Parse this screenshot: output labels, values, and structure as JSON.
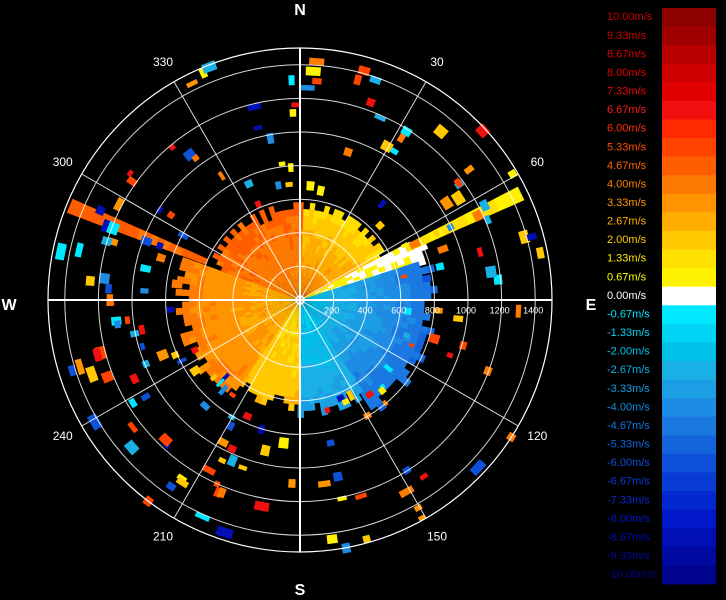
{
  "chart_data": {
    "type": "heatmap",
    "subtype": "polar radial-velocity PPI",
    "cardinal_labels": {
      "north": "N",
      "east": "E",
      "south": "S",
      "west": "W"
    },
    "bearing_labels": [
      {
        "deg": 30,
        "text": "30"
      },
      {
        "deg": 60,
        "text": "60"
      },
      {
        "deg": 120,
        "text": "120"
      },
      {
        "deg": 150,
        "text": "150"
      },
      {
        "deg": 210,
        "text": "210"
      },
      {
        "deg": 240,
        "text": "240"
      },
      {
        "deg": 300,
        "text": "300"
      },
      {
        "deg": 330,
        "text": "330"
      }
    ],
    "range_rings": [
      200,
      400,
      600,
      800,
      1000,
      1200,
      1400
    ],
    "range_labels": [
      "200",
      "400",
      "600",
      "800",
      "1000",
      "1200",
      "1400"
    ],
    "range_max": 1500,
    "spoke_interval_deg": 30,
    "colorbar": [
      {
        "value": 10.0,
        "label": "10.00m/s",
        "color": "#8c0000",
        "text_color": "#cc0000"
      },
      {
        "value": 9.33,
        "label": "9.33m/s",
        "color": "#a00000",
        "text_color": "#cc0000"
      },
      {
        "value": 8.67,
        "label": "8.67m/s",
        "color": "#b80000",
        "text_color": "#dd0000"
      },
      {
        "value": 8.0,
        "label": "8.00m/s",
        "color": "#cc0000",
        "text_color": "#e00000"
      },
      {
        "value": 7.33,
        "label": "7.33m/s",
        "color": "#e00000",
        "text_color": "#ee0000"
      },
      {
        "value": 6.67,
        "label": "6.67m/s",
        "color": "#f01010",
        "text_color": "#ff1a1a"
      },
      {
        "value": 6.0,
        "label": "6.00m/s",
        "color": "#ff2a00",
        "text_color": "#ff3300"
      },
      {
        "value": 5.33,
        "label": "5.33m/s",
        "color": "#ff4400",
        "text_color": "#ff4d00"
      },
      {
        "value": 4.67,
        "label": "4.67m/s",
        "color": "#ff5e00",
        "text_color": "#ff6600"
      },
      {
        "value": 4.0,
        "label": "4.00m/s",
        "color": "#ff7a00",
        "text_color": "#ff8000"
      },
      {
        "value": 3.33,
        "label": "3.33m/s",
        "color": "#ff9400",
        "text_color": "#ff9900"
      },
      {
        "value": 2.67,
        "label": "2.67m/s",
        "color": "#ffae00",
        "text_color": "#ffb300"
      },
      {
        "value": 2.0,
        "label": "2.00m/s",
        "color": "#ffc800",
        "text_color": "#ffcc00"
      },
      {
        "value": 1.33,
        "label": "1.33m/s",
        "color": "#ffe000",
        "text_color": "#ffe600"
      },
      {
        "value": 0.67,
        "label": "0.67m/s",
        "color": "#fff200",
        "text_color": "#ffff00"
      },
      {
        "value": 0.0,
        "label": "0.00m/s",
        "color": "#ffffff",
        "text_color": "#ffffff"
      },
      {
        "value": -0.67,
        "label": "-0.67m/s",
        "color": "#00e8ff",
        "text_color": "#00e5ff"
      },
      {
        "value": -1.33,
        "label": "-1.33m/s",
        "color": "#00d4f5",
        "text_color": "#00d5f5"
      },
      {
        "value": -2.0,
        "label": "-2.00m/s",
        "color": "#00c0ea",
        "text_color": "#00c2ea"
      },
      {
        "value": -2.67,
        "label": "-2.67m/s",
        "color": "#1ab0e6",
        "text_color": "#10b0e6"
      },
      {
        "value": -3.33,
        "label": "-3.33m/s",
        "color": "#1c9ee4",
        "text_color": "#109ee4"
      },
      {
        "value": -4.0,
        "label": "-4.00m/s",
        "color": "#1e8ce2",
        "text_color": "#108ce2"
      },
      {
        "value": -4.67,
        "label": "-4.67m/s",
        "color": "#1a78e0",
        "text_color": "#1078e0"
      },
      {
        "value": -5.33,
        "label": "-5.33m/s",
        "color": "#1464dc",
        "text_color": "#1064dc"
      },
      {
        "value": -6.0,
        "label": "-6.00m/s",
        "color": "#0e50d8",
        "text_color": "#0e50d8"
      },
      {
        "value": -6.67,
        "label": "-6.67m/s",
        "color": "#083cd4",
        "text_color": "#083cd4"
      },
      {
        "value": -7.33,
        "label": "-7.33m/s",
        "color": "#0428d0",
        "text_color": "#0428d0"
      },
      {
        "value": -8.0,
        "label": "-8.00m/s",
        "color": "#0018c8",
        "text_color": "#0018c8"
      },
      {
        "value": -8.67,
        "label": "-8.67m/s",
        "color": "#0010b4",
        "text_color": "#0010b4"
      },
      {
        "value": -9.33,
        "label": "-9.33m/s",
        "color": "#000aa0",
        "text_color": "#000aa0"
      },
      {
        "value": -10.0,
        "label": "-10.00m/s",
        "color": "#00048c",
        "text_color": "#00048c"
      }
    ],
    "velocity_field": {
      "description_none": "",
      "sectors": [
        {
          "az_from": 0,
          "az_to": 62,
          "r_from": 0,
          "r_to": 580,
          "v_from": 3.8,
          "v_to": 1.2
        },
        {
          "az_from": 62,
          "az_to": 72,
          "r_from": 0,
          "r_to": 800,
          "v_from": 0.6,
          "v_to": 0.0
        },
        {
          "az_from": 72,
          "az_to": 145,
          "r_from": 0,
          "r_to": 820,
          "v_from": -1.8,
          "v_to": -5.2
        },
        {
          "az_from": 145,
          "az_to": 180,
          "r_from": 0,
          "r_to": 700,
          "v_from": -1.4,
          "v_to": -3.4
        },
        {
          "az_from": 180,
          "az_to": 215,
          "r_from": 0,
          "r_to": 640,
          "v_from": 1.4,
          "v_to": 2.2
        },
        {
          "az_from": 215,
          "az_to": 290,
          "r_from": 0,
          "r_to": 720,
          "v_from": 2.4,
          "v_to": 3.9
        },
        {
          "az_from": 290,
          "az_to": 360,
          "r_from": 0,
          "r_to": 560,
          "v_from": 3.6,
          "v_to": 4.6
        }
      ],
      "strong_returns": [
        {
          "az": 64,
          "r_from": 700,
          "r_to": 1450,
          "v": 1.0
        },
        {
          "az": 292,
          "r_from": 600,
          "r_to": 1450,
          "v": 4.5
        }
      ],
      "scatter_echoes_count": 180
    }
  }
}
